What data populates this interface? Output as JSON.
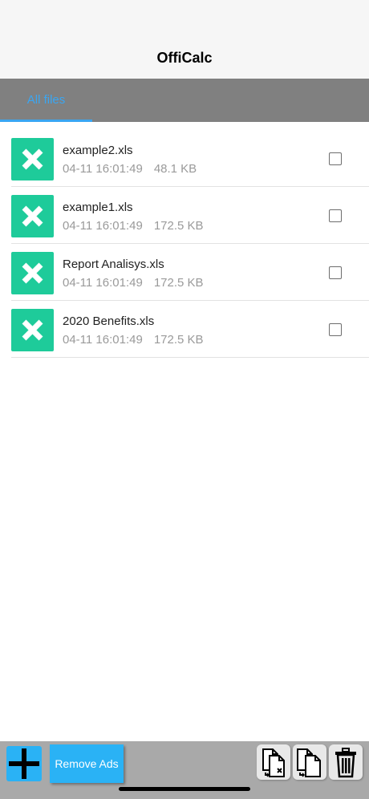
{
  "app": {
    "title": "OffiCalc"
  },
  "tabs": [
    {
      "label": "All files",
      "active": true
    }
  ],
  "files": [
    {
      "name": "example2.xls",
      "date": "04-11 16:01:49",
      "size": "48.1 KB",
      "checked": false
    },
    {
      "name": "example1.xls",
      "date": "04-11 16:01:49",
      "size": "172.5 KB",
      "checked": false
    },
    {
      "name": "Report Analisys.xls",
      "date": "04-11 16:01:49",
      "size": "172.5 KB",
      "checked": false
    },
    {
      "name": "2020 Benefits.xls",
      "date": "04-11 16:01:49",
      "size": "172.5 KB",
      "checked": false
    }
  ],
  "toolbar": {
    "add_icon": "plus-icon",
    "remove_ads_label": "Remove Ads",
    "move_icon": "file-move-icon",
    "copy_icon": "file-copy-icon",
    "delete_icon": "trash-icon"
  },
  "colors": {
    "accent": "#3aa6f2",
    "button_blue": "#2ab2f5",
    "excel_green": "#1ecb9a",
    "tab_bar_gray": "#808080",
    "bottom_bar_gray": "#a9a9a9"
  }
}
